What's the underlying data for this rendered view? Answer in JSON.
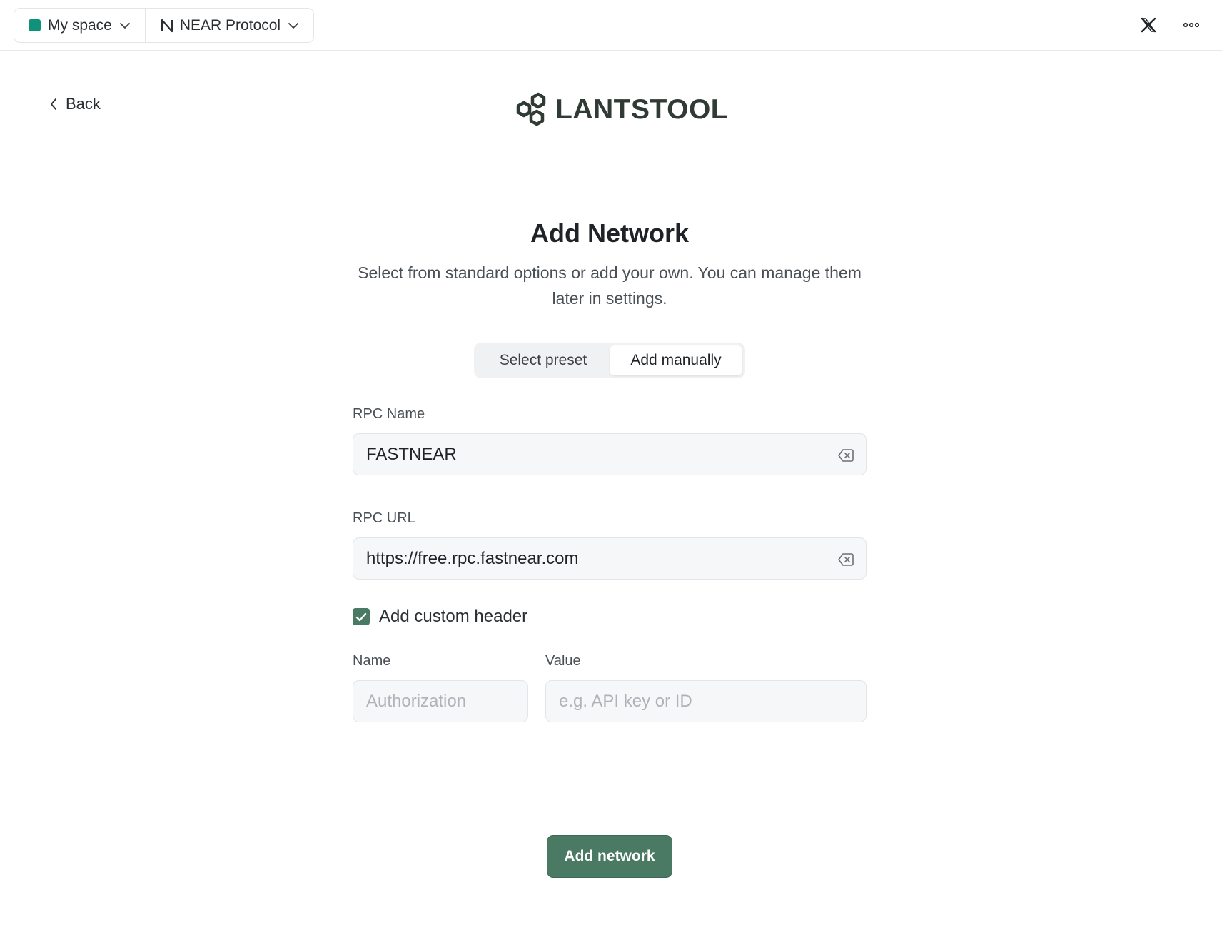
{
  "topbar": {
    "space_label": "My space",
    "space_color": "#10917a",
    "network_label": "NEAR Protocol",
    "icons": [
      "x-logo-icon",
      "more-icon"
    ]
  },
  "back_label": "Back",
  "brand": {
    "name": "LANTSTOOL",
    "color": "#2f3b34"
  },
  "form": {
    "title": "Add Network",
    "subtitle": "Select from standard options or add your own. You can manage them later in settings.",
    "tabs": [
      {
        "label": "Select preset",
        "active": false
      },
      {
        "label": "Add manually",
        "active": true
      }
    ],
    "rpc_name": {
      "label": "RPC Name",
      "value": "FASTNEAR"
    },
    "rpc_url": {
      "label": "RPC URL",
      "value": "https://free.rpc.fastnear.com"
    },
    "custom_header": {
      "label": "Add custom header",
      "checked": true
    },
    "header_name": {
      "label": "Name",
      "placeholder": "Authorization",
      "value": ""
    },
    "header_value": {
      "label": "Value",
      "placeholder": "e.g. API key or ID",
      "value": ""
    },
    "submit_label": "Add network"
  },
  "accent_color": "#4a7a63"
}
